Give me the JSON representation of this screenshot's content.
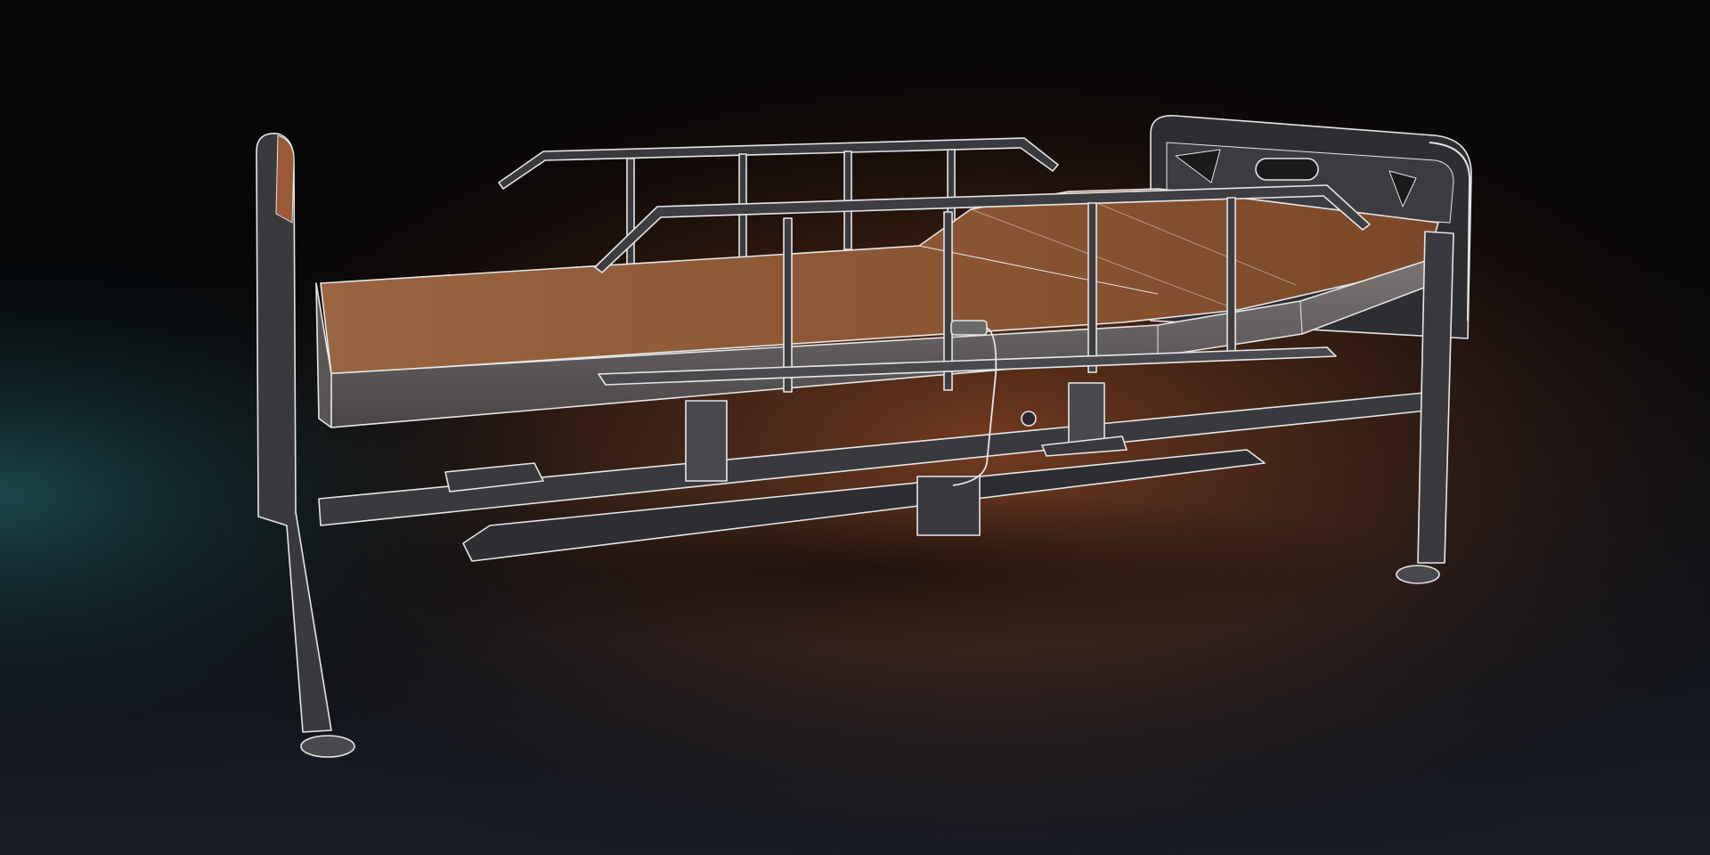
{
  "scene": {
    "subject": "hospital-bed-wireframe-render",
    "colors": {
      "background_top": "#050506",
      "background_floor": "#141820",
      "glow_orange": "#c8612a",
      "glow_teal": "#1e5a5e",
      "mattress_top": "#8a5432",
      "mattress_side": "#6e6a6a",
      "frame_fill": "#3a3a3e",
      "wire": "#e8e8e8",
      "frame_dark": "#2a2a2e"
    }
  }
}
